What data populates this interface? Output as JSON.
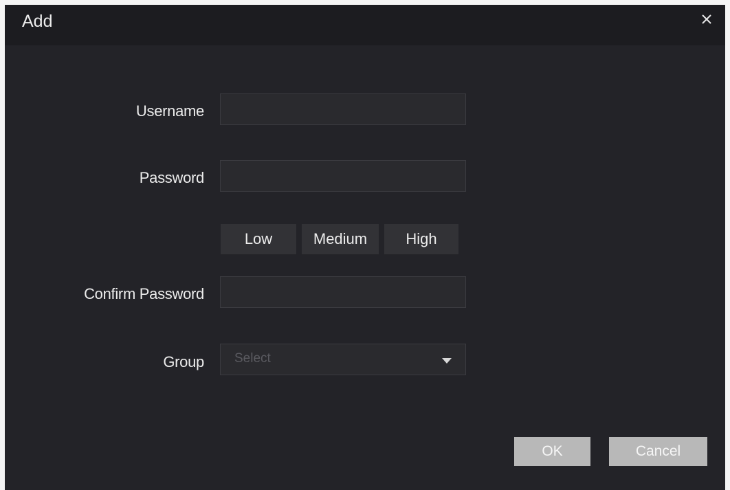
{
  "dialog": {
    "title": "Add"
  },
  "form": {
    "username_label": "Username",
    "username_value": "",
    "password_label": "Password",
    "password_value": "",
    "strength": {
      "low": "Low",
      "medium": "Medium",
      "high": "High"
    },
    "confirm_label": "Confirm Password",
    "confirm_value": "",
    "group_label": "Group",
    "group_placeholder": "Select"
  },
  "footer": {
    "ok": "OK",
    "cancel": "Cancel"
  },
  "icons": {
    "close": "close-icon",
    "dropdown": "chevron-down-icon"
  },
  "colors": {
    "background": "#232328",
    "titlebar": "#1c1c20",
    "button": "#b8b8b8",
    "text": "#ececec"
  }
}
